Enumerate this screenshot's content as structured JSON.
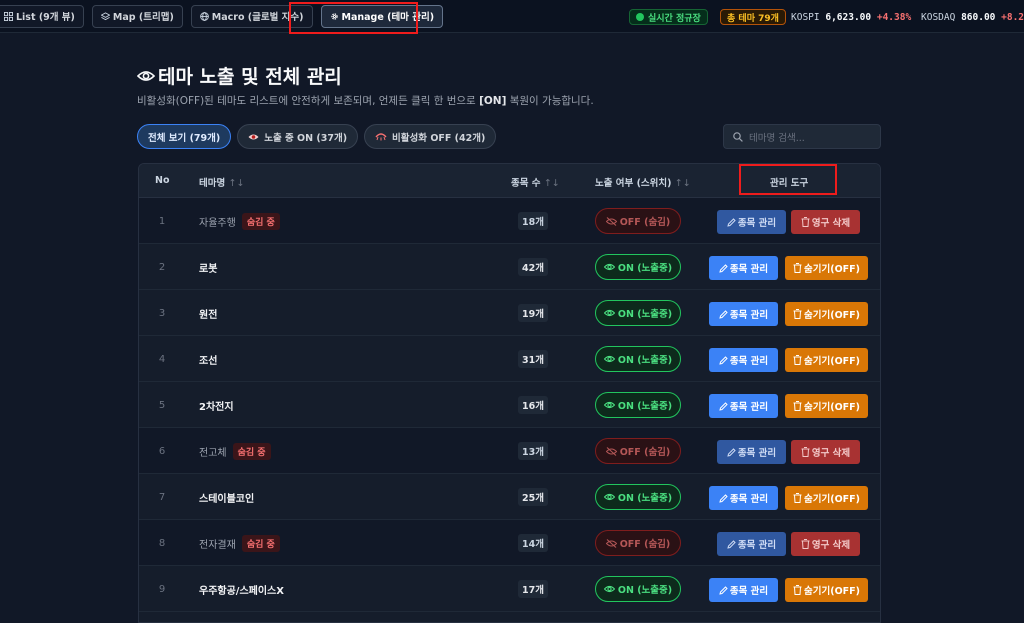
{
  "nav": {
    "tabs": [
      {
        "label": "List (9개 뷰)",
        "icon": "grid-icon"
      },
      {
        "label": "Map (트리맵)",
        "icon": "layers-icon"
      },
      {
        "label": "Macro (글로벌 지수)",
        "icon": "globe-icon"
      },
      {
        "label": "Manage (테마 관리)",
        "icon": "gear-icon",
        "active": true
      }
    ]
  },
  "status": {
    "live": "실시간 정규장",
    "total": "총 테마 79개",
    "tickers": [
      {
        "name": "KOSPI",
        "value": "6,623.00",
        "change": "+4.38%"
      },
      {
        "name": "KOSDAQ",
        "value": "860.00",
        "change": "+8.2"
      }
    ]
  },
  "page": {
    "title": "테마 노출 및 전체 관리",
    "desc_part1": "비활성화(OFF)된 테마도 리스트에 안전하게 보존되며, 언제든 클릭 한 번으로 ",
    "desc_bold": "[ON]",
    "desc_part2": " 복원이 가능합니다."
  },
  "filters": {
    "all": "전체 보기 (79개)",
    "on": "노출 중 ON (37개)",
    "off": "비활성화 OFF (42개)"
  },
  "search": {
    "placeholder": "테마명 검색..."
  },
  "table": {
    "headers": {
      "no": "No",
      "name": "테마명",
      "count": "종목 수",
      "toggle": "노출 여부 (스위치)",
      "tools": "관리 도구"
    },
    "hidden_badge": "숨김 중",
    "on_label": "ON (노출중)",
    "off_label": "OFF (숨김)",
    "edit_label": "종목 관리",
    "hide_label": "숨기기(OFF)",
    "delete_label": "영구 삭제",
    "rows": [
      {
        "no": "1",
        "name": "자율주행",
        "count": "18개",
        "on": false
      },
      {
        "no": "2",
        "name": "로봇",
        "count": "42개",
        "on": true
      },
      {
        "no": "3",
        "name": "원전",
        "count": "19개",
        "on": true
      },
      {
        "no": "4",
        "name": "조선",
        "count": "31개",
        "on": true
      },
      {
        "no": "5",
        "name": "2차전지",
        "count": "16개",
        "on": true
      },
      {
        "no": "6",
        "name": "전고체",
        "count": "13개",
        "on": false
      },
      {
        "no": "7",
        "name": "스테이블코인",
        "count": "25개",
        "on": true
      },
      {
        "no": "8",
        "name": "전자결재",
        "count": "14개",
        "on": false
      },
      {
        "no": "9",
        "name": "우주항공/스페이스X",
        "count": "17개",
        "on": true
      }
    ]
  },
  "colors": {
    "accent": "#3b82f6",
    "on": "#22c55e",
    "hide": "#d97706",
    "delete": "#a83232",
    "highlight": "#ef1c1c"
  }
}
